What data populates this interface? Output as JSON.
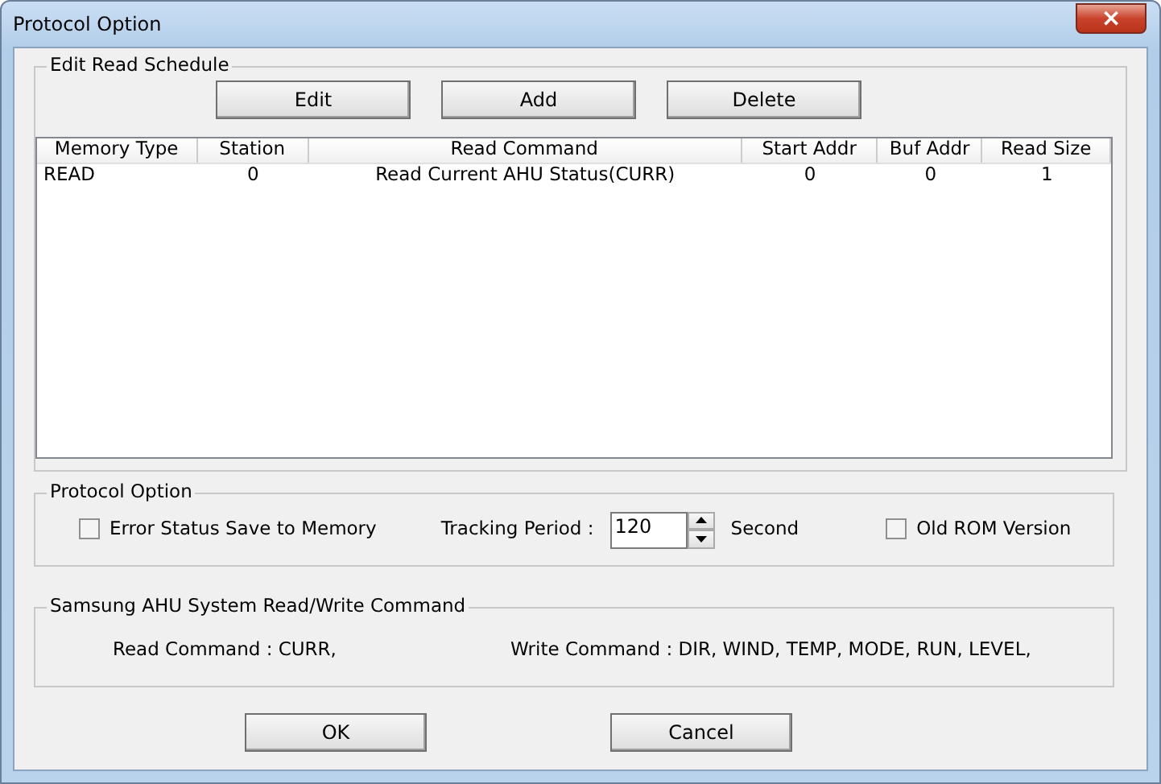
{
  "window": {
    "title": "Protocol Option",
    "close": "×"
  },
  "schedule": {
    "title": "Edit Read Schedule",
    "buttons": [
      "Edit",
      "Add",
      "Delete"
    ],
    "columns": [
      "Memory Type",
      "Station",
      "Read Command",
      "Start Addr",
      "Buf Addr",
      "Read Size"
    ],
    "rows": [
      {
        "cells": [
          "READ",
          "0",
          "Read Current AHU Status(CURR)",
          "0",
          "0",
          "1"
        ],
        "selected": false
      }
    ]
  },
  "protocol": {
    "title": "Protocol Option",
    "error_status": {
      "label": "Error Status Save to Memory",
      "checked": false
    },
    "tracking_label": "Tracking Period :",
    "tracking_value": "120",
    "tracking_unit": "Second",
    "old_rom": {
      "label": "Old ROM Version",
      "checked": false
    }
  },
  "commands": {
    "title": "Samsung AHU System Read/Write Command",
    "read": "Read Command : CURR,",
    "write": "Write Command : DIR, WIND, TEMP, MODE, RUN, LEVEL,"
  },
  "buttons": [
    "OK",
    "Cancel"
  ]
}
